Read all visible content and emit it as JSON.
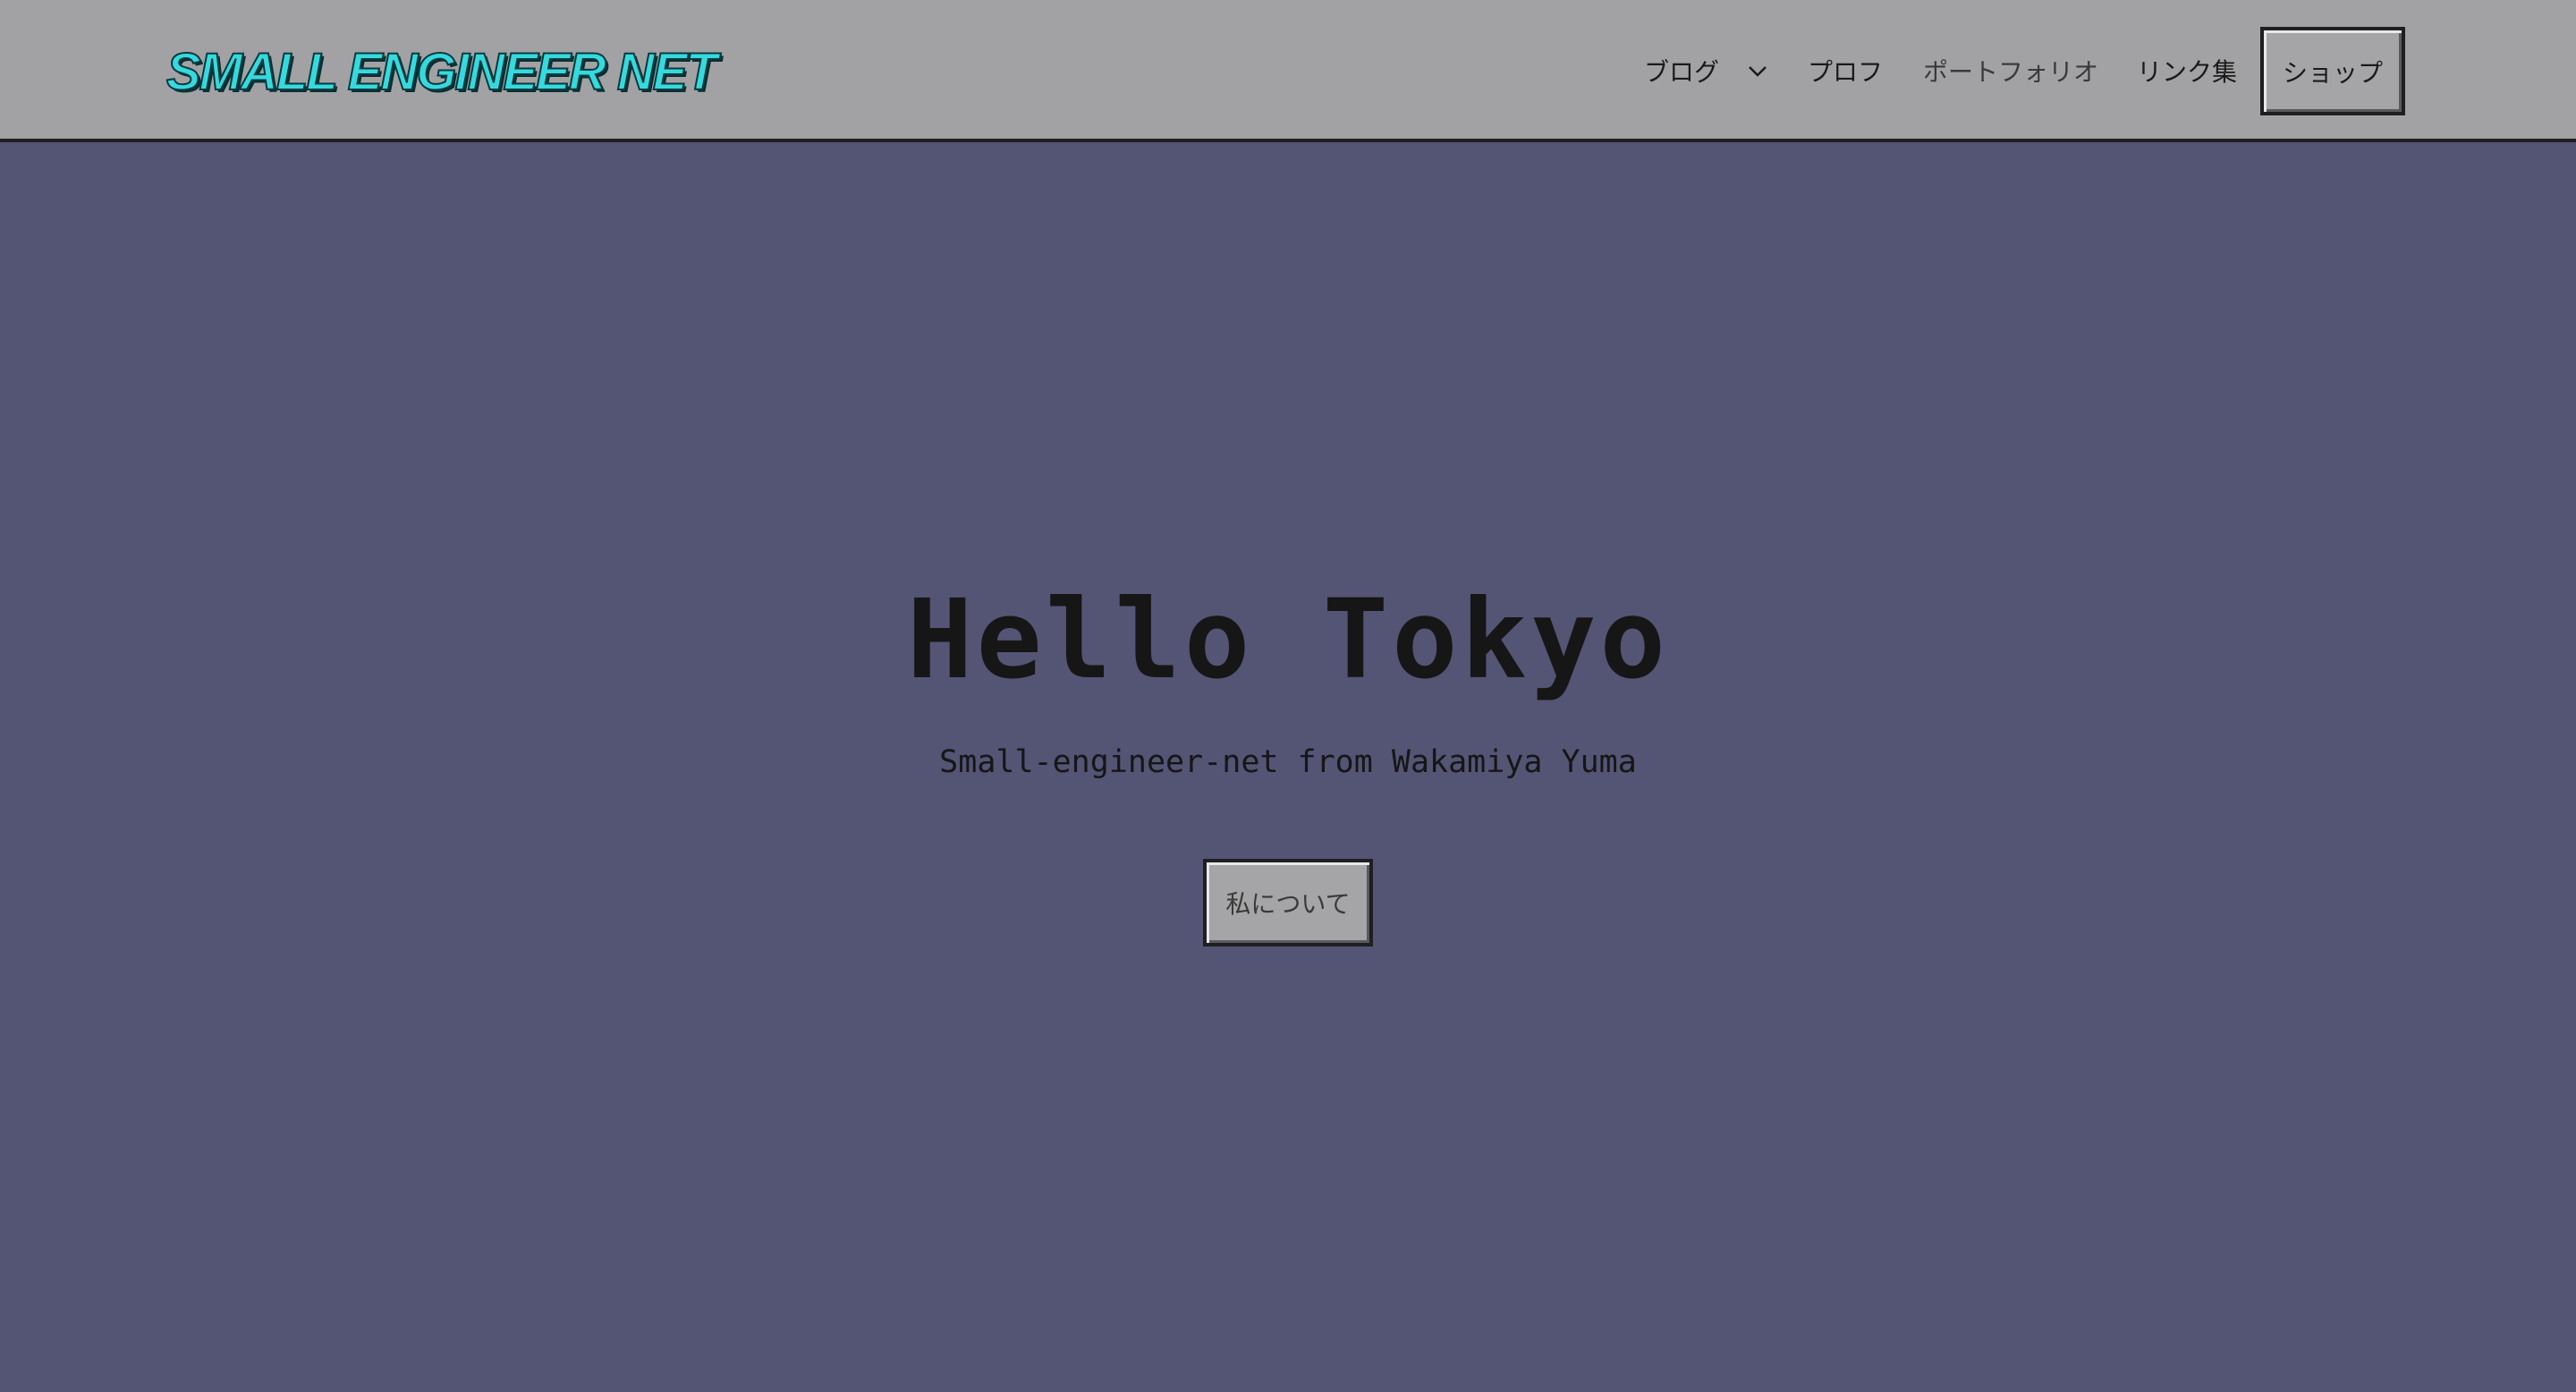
{
  "header": {
    "logo_text": "SMALL ENGINEER NET",
    "logo_color": "#36d9dd",
    "background_color": "#a2a2a4"
  },
  "nav": {
    "items": [
      {
        "label": "ブログ",
        "has_dropdown": true,
        "icon": "chevron-down-icon"
      },
      {
        "label": "プロフ"
      },
      {
        "label": "ポートフォリオ"
      },
      {
        "label": "リンク集"
      }
    ],
    "shop_label": "ショップ"
  },
  "hero": {
    "title": "Hello Tokyo",
    "subtitle": "Small-engineer-net from Wakamiya Yuma",
    "button_label": "私について",
    "background_color": "#545475"
  }
}
